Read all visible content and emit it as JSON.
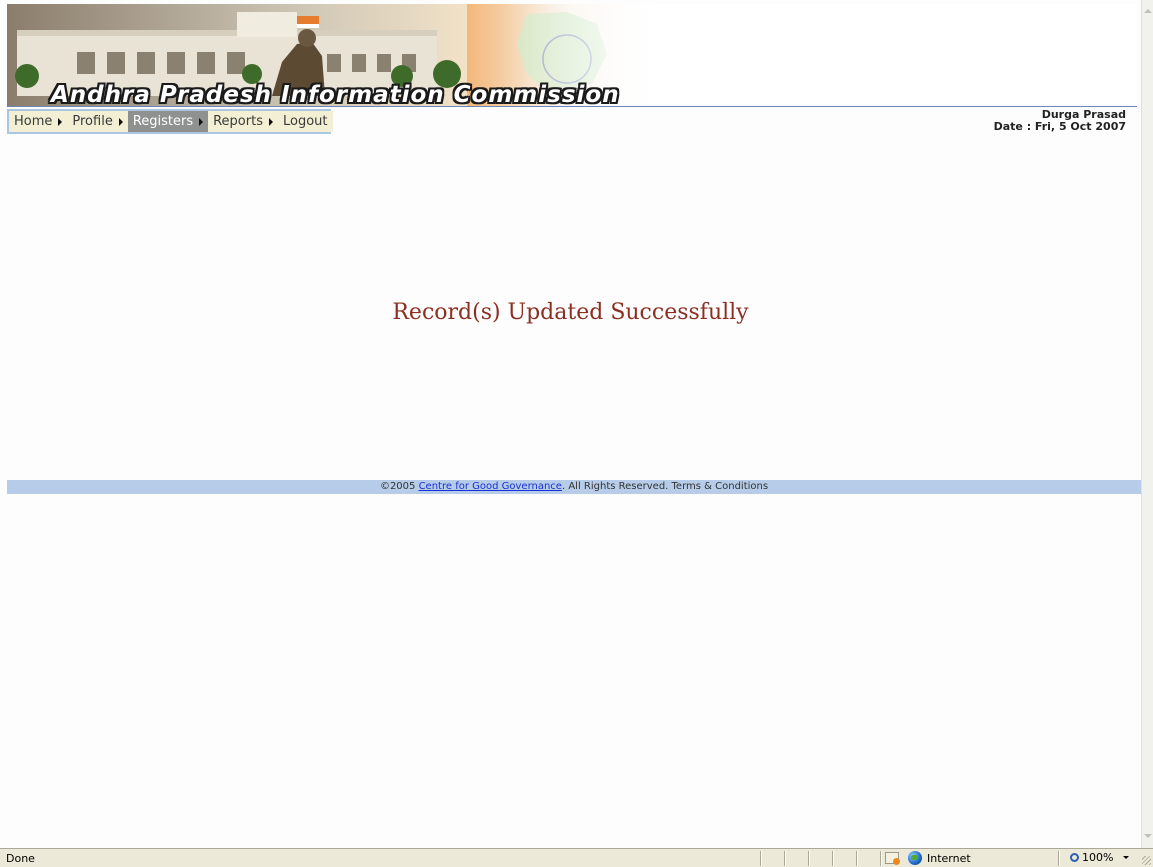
{
  "banner": {
    "title": "Andhra Pradesh Information Commission"
  },
  "menu": {
    "items": [
      {
        "label": "Home",
        "arrow": true,
        "active": false
      },
      {
        "label": "Profile",
        "arrow": true,
        "active": false
      },
      {
        "label": "Registers",
        "arrow": true,
        "active": true
      },
      {
        "label": "Reports",
        "arrow": true,
        "active": false
      },
      {
        "label": "Logout",
        "arrow": false,
        "active": false
      }
    ]
  },
  "user": {
    "name": "Durga Prasad",
    "date": "Date : Fri, 5 Oct 2007"
  },
  "main": {
    "message": "Record(s) Updated Successfully"
  },
  "footer": {
    "copyright": "©2005",
    "link": "Centre for Good Governance",
    "rest": ". All Rights Reserved. Terms & Conditions"
  },
  "statusbar": {
    "status": "Done",
    "zone": "Internet",
    "zoom": "100%"
  },
  "colors": {
    "message": "#8b2f22",
    "footer_bg": "#b6cce8",
    "menu_bg": "#f3efd4",
    "menu_active_bg": "#8f9090"
  },
  "icons": [
    "menu-arrow-icon",
    "scroll-up-icon",
    "scroll-down-icon",
    "security-zone-icon",
    "globe-icon",
    "zoom-icon",
    "dropdown-arrow-icon",
    "resize-grip-icon"
  ]
}
